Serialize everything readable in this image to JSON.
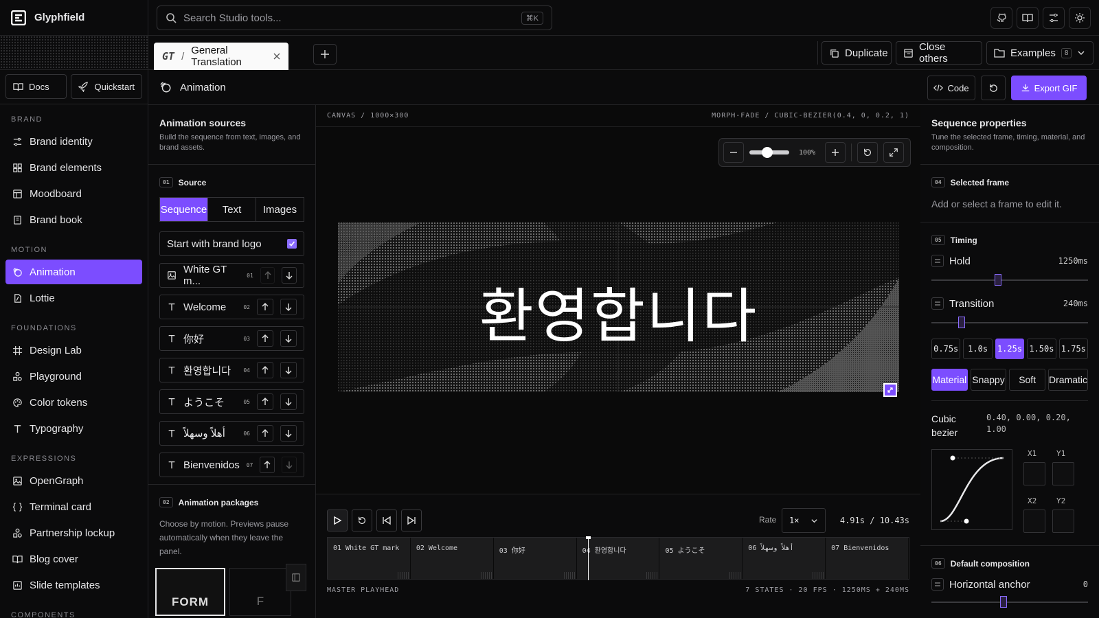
{
  "app": {
    "name": "Glyphfield"
  },
  "search": {
    "placeholder": "Search Studio tools...",
    "shortcut": "⌘K"
  },
  "sidebar": {
    "quick": [
      {
        "label": "Docs"
      },
      {
        "label": "Quickstart"
      }
    ],
    "sections": [
      {
        "label": "BRAND",
        "items": [
          "Brand identity",
          "Brand elements",
          "Moodboard",
          "Brand book"
        ]
      },
      {
        "label": "MOTION",
        "items": [
          "Animation",
          "Lottie"
        ]
      },
      {
        "label": "FOUNDATIONS",
        "items": [
          "Design Lab",
          "Playground",
          "Color tokens",
          "Typography"
        ]
      },
      {
        "label": "EXPRESSIONS",
        "items": [
          "OpenGraph",
          "Terminal card",
          "Partnership lockup",
          "Blog cover",
          "Slide templates"
        ]
      },
      {
        "label": "COMPONENTS",
        "items": []
      }
    ],
    "active": "Animation"
  },
  "tabbar": {
    "tab": {
      "prefix": "GT",
      "sep": "/",
      "title": "General Translation"
    },
    "duplicate": "Duplicate",
    "close_others": "Close others",
    "examples": "Examples",
    "examples_count": "8"
  },
  "header": {
    "title": "Animation",
    "code": "Code",
    "export": "Export GIF"
  },
  "sources": {
    "title": "Animation sources",
    "subtitle": "Build the sequence from text, images, and brand assets.",
    "source": {
      "num": "01",
      "label": "Source"
    },
    "segments": [
      "Sequence",
      "Text",
      "Images"
    ],
    "active_segment": "Sequence",
    "brand_logo": {
      "label": "Start with brand logo",
      "checked": true
    },
    "items": [
      {
        "icon": "image-icon",
        "label": "White GT m...",
        "idx": "01"
      },
      {
        "icon": "text-icon",
        "label": "Welcome",
        "idx": "02"
      },
      {
        "icon": "text-icon",
        "label": "你好",
        "idx": "03"
      },
      {
        "icon": "text-icon",
        "label": "환영합니다",
        "idx": "04"
      },
      {
        "icon": "text-icon",
        "label": "ようこそ",
        "idx": "05"
      },
      {
        "icon": "text-icon",
        "label": "أهلاً وسهلاً",
        "idx": "06"
      },
      {
        "icon": "text-icon",
        "label": "Bienvenidos",
        "idx": "07"
      }
    ],
    "packages": {
      "num": "02",
      "label": "Animation packages",
      "desc": "Choose by motion. Previews pause automatically when they leave the panel.",
      "preview1": "FORM",
      "preview2": "F"
    }
  },
  "canvas": {
    "left_label": "CANVAS / 1000×300",
    "right_label": "MORPH-FADE / CUBIC-BEZIER(0.4, 0, 0.2, 1)",
    "zoom": "100%",
    "zoom_fraction": 0.35,
    "word": "환영합니다"
  },
  "transport": {
    "rate_label": "Rate",
    "rate": "1×",
    "time": "4.91s / 10.43s",
    "clips": [
      "01 White GT mark",
      "02 Welcome",
      "03 你好",
      "04 환영합니다",
      "05 ようこそ",
      "06 أهلاً وسهلاً",
      "07 Bienvenidos"
    ],
    "playhead_label": "MASTER PLAYHEAD",
    "stats": "7 STATES · 20 FPS · 1250MS + 240MS"
  },
  "props": {
    "title": "Sequence properties",
    "subtitle": "Tune the selected frame, timing, material, and composition.",
    "selected": {
      "num": "04",
      "label": "Selected frame",
      "hint": "Add or select a frame to edit it."
    },
    "timing": {
      "num": "05",
      "label": "Timing",
      "hold": {
        "label": "Hold",
        "value": "1250ms",
        "fraction": 0.42
      },
      "transition": {
        "label": "Transition",
        "value": "240ms",
        "fraction": 0.18
      },
      "presets": [
        "0.75s",
        "1.0s",
        "1.25s",
        "1.50s",
        "1.75s"
      ],
      "active_preset": "1.25s",
      "materials": [
        "Material",
        "Snappy",
        "Soft",
        "Dramatic"
      ],
      "active_material": "Material",
      "bezier_label": "Cubic bezier",
      "bezier_value": "0.40, 0.00, 0.20, 1.00",
      "x1": "X1",
      "y1": "Y1",
      "x2": "X2",
      "y2": "Y2"
    },
    "composition": {
      "num": "06",
      "label": "Default composition",
      "h_anchor": {
        "label": "Horizontal anchor",
        "value": "0"
      }
    }
  },
  "colors": {
    "accent": "#7c4dff",
    "bg": "#0b0b0c"
  }
}
